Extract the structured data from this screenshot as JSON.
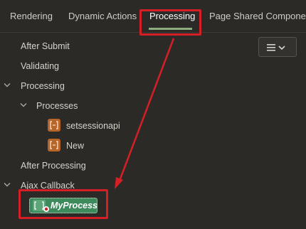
{
  "tabs": [
    {
      "label": "Rendering"
    },
    {
      "label": "Dynamic Actions"
    },
    {
      "label": "Processing"
    },
    {
      "label": "Page Shared Components"
    }
  ],
  "tree": {
    "after_submit": "After Submit",
    "validating": "Validating",
    "processing": "Processing",
    "processes": "Processes",
    "items": [
      {
        "label": "setsessionapi"
      },
      {
        "label": "New"
      }
    ],
    "after_processing": "After Processing",
    "ajax_callback": "Ajax Callback",
    "selected_process": "MyProcess"
  },
  "colors": {
    "active_tab_underline": "#8dab7c",
    "highlight": "#d51f26",
    "process_icon": "#b8652a",
    "selected_node": "#3d8a5c"
  }
}
